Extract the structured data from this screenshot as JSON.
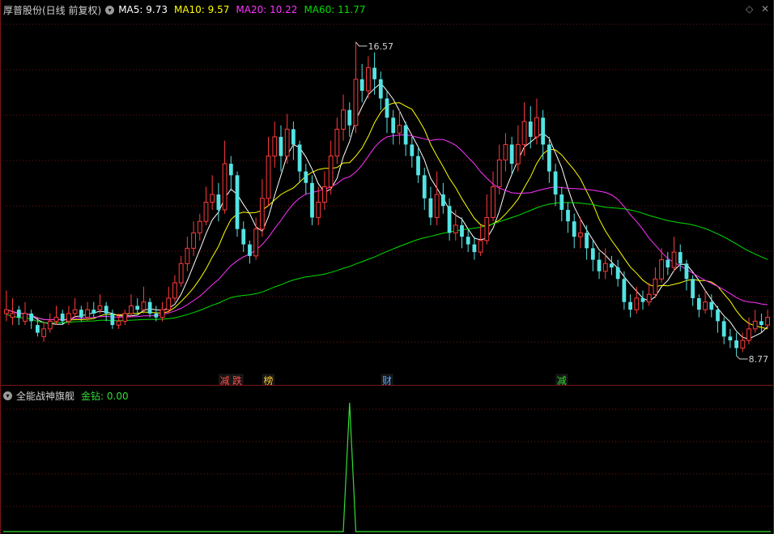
{
  "header": {
    "stock_name": "厚普股份(日线 前复权)",
    "dropdown_glyph": "▾",
    "ma": [
      {
        "label": "MA5: 9.73",
        "color": "#ffffff"
      },
      {
        "label": "MA10: 9.57",
        "color": "#ffff00"
      },
      {
        "label": "MA20: 10.22",
        "color": "#ff33ff"
      },
      {
        "label": "MA60: 11.77",
        "color": "#00e000"
      }
    ],
    "controls": [
      "◇",
      "✕"
    ]
  },
  "annotations": {
    "high": "16.57",
    "low": "8.77",
    "tags": [
      {
        "text": "减",
        "color": "#ff5050"
      },
      {
        "text": "跌",
        "color": "#ff5050"
      },
      {
        "text": "榜",
        "color": "#ffcc33"
      },
      {
        "text": "财",
        "color": "#55aaff"
      },
      {
        "text": "减",
        "color": "#33dd33"
      }
    ]
  },
  "indicator": {
    "name": "全能战神旗舰",
    "value_label": "金钻: 0.00",
    "value_color": "#33dd33"
  },
  "colors": {
    "up": "#ff3b3b",
    "down": "#54e3e3",
    "grid": "#7a1515"
  },
  "chart_data": {
    "type": "line",
    "ohlc": [
      [
        9.5,
        9.6,
        10.1,
        9.3
      ],
      [
        9.4,
        9.5,
        9.9,
        9.2
      ],
      [
        9.6,
        9.4,
        9.7,
        9.2
      ],
      [
        9.3,
        9.5,
        9.8,
        9.2
      ],
      [
        9.5,
        9.3,
        9.6,
        9.1
      ],
      [
        9.2,
        9.0,
        9.4,
        8.9
      ],
      [
        8.9,
        9.1,
        9.3,
        8.77
      ],
      [
        9.1,
        9.3,
        9.5,
        9.0
      ],
      [
        9.3,
        9.4,
        9.7,
        9.2
      ],
      [
        9.5,
        9.3,
        9.6,
        9.2
      ],
      [
        9.3,
        9.5,
        9.7,
        9.2
      ],
      [
        9.5,
        9.6,
        9.9,
        9.4
      ],
      [
        9.6,
        9.4,
        9.7,
        9.3
      ],
      [
        9.4,
        9.6,
        9.8,
        9.3
      ],
      [
        9.6,
        9.5,
        9.8,
        9.4
      ],
      [
        9.6,
        9.7,
        10.0,
        9.5
      ],
      [
        9.7,
        9.5,
        9.8,
        9.3
      ],
      [
        9.5,
        9.2,
        9.6,
        9.1
      ],
      [
        9.2,
        9.3,
        9.5,
        9.1
      ],
      [
        9.3,
        9.5,
        9.6,
        9.2
      ],
      [
        9.5,
        9.7,
        10.0,
        9.4
      ],
      [
        9.7,
        9.6,
        9.9,
        9.5
      ],
      [
        9.6,
        9.8,
        10.2,
        9.5
      ],
      [
        9.8,
        9.5,
        9.9,
        9.4
      ],
      [
        9.5,
        9.4,
        9.7,
        9.3
      ],
      [
        9.4,
        9.6,
        9.8,
        9.3
      ],
      [
        9.6,
        9.9,
        10.2,
        9.5
      ],
      [
        9.9,
        10.3,
        10.5,
        9.8
      ],
      [
        10.3,
        10.8,
        11.0,
        10.2
      ],
      [
        10.8,
        11.2,
        11.5,
        10.6
      ],
      [
        11.2,
        11.6,
        11.9,
        11.0
      ],
      [
        11.6,
        11.9,
        12.1,
        11.4
      ],
      [
        11.9,
        12.4,
        12.8,
        11.8
      ],
      [
        12.4,
        12.6,
        13.1,
        12.2
      ],
      [
        12.6,
        12.2,
        12.9,
        11.9
      ],
      [
        12.2,
        13.4,
        14.0,
        12.1
      ],
      [
        13.4,
        13.1,
        13.6,
        12.7
      ],
      [
        13.1,
        11.7,
        13.2,
        11.5
      ],
      [
        11.7,
        11.3,
        11.9,
        11.1
      ],
      [
        11.3,
        11.0,
        11.4,
        10.8
      ],
      [
        11.0,
        11.7,
        12.0,
        10.9
      ],
      [
        11.7,
        12.5,
        13.0,
        11.5
      ],
      [
        12.5,
        13.6,
        14.1,
        12.3
      ],
      [
        13.6,
        14.1,
        14.5,
        13.3
      ],
      [
        14.1,
        13.6,
        14.4,
        13.2
      ],
      [
        13.6,
        14.3,
        14.7,
        13.4
      ],
      [
        14.3,
        13.9,
        14.5,
        13.5
      ],
      [
        13.9,
        13.2,
        14.0,
        12.9
      ],
      [
        13.2,
        12.9,
        13.4,
        12.6
      ],
      [
        12.9,
        12.0,
        13.1,
        11.8
      ],
      [
        12.0,
        12.4,
        12.8,
        11.8
      ],
      [
        12.4,
        12.8,
        13.2,
        12.2
      ],
      [
        12.8,
        13.6,
        14.0,
        12.6
      ],
      [
        13.6,
        14.3,
        14.6,
        13.4
      ],
      [
        14.3,
        14.8,
        15.2,
        14.0
      ],
      [
        14.8,
        14.4,
        15.0,
        14.1
      ],
      [
        14.4,
        15.6,
        16.57,
        14.2
      ],
      [
        15.6,
        15.3,
        16.0,
        15.0
      ],
      [
        15.3,
        15.9,
        16.2,
        15.1
      ],
      [
        15.9,
        15.6,
        16.3,
        15.2
      ],
      [
        15.6,
        15.1,
        15.8,
        14.8
      ],
      [
        15.1,
        14.6,
        15.3,
        14.2
      ],
      [
        14.6,
        14.2,
        14.8,
        13.9
      ],
      [
        14.2,
        14.4,
        14.8,
        13.9
      ],
      [
        14.4,
        13.9,
        14.5,
        13.6
      ],
      [
        13.9,
        13.6,
        14.1,
        13.3
      ],
      [
        13.6,
        13.1,
        13.8,
        12.9
      ],
      [
        13.1,
        12.5,
        13.3,
        12.2
      ],
      [
        12.5,
        12.0,
        12.8,
        11.8
      ],
      [
        12.0,
        12.6,
        13.2,
        11.8
      ],
      [
        12.6,
        12.3,
        12.9,
        12.1
      ],
      [
        12.3,
        11.6,
        12.5,
        11.4
      ],
      [
        11.6,
        11.8,
        12.2,
        11.4
      ],
      [
        11.8,
        11.5,
        12.0,
        11.2
      ],
      [
        11.5,
        11.3,
        11.7,
        11.1
      ],
      [
        11.3,
        11.1,
        11.5,
        10.9
      ],
      [
        11.1,
        11.4,
        11.8,
        11.0
      ],
      [
        11.4,
        12.0,
        12.6,
        11.3
      ],
      [
        12.0,
        12.8,
        13.2,
        11.9
      ],
      [
        12.8,
        13.5,
        13.9,
        12.6
      ],
      [
        13.5,
        13.9,
        14.2,
        13.2
      ],
      [
        13.9,
        13.4,
        14.1,
        13.1
      ],
      [
        13.4,
        13.9,
        14.4,
        13.2
      ],
      [
        13.9,
        14.5,
        15.0,
        13.6
      ],
      [
        14.5,
        14.1,
        14.9,
        13.8
      ],
      [
        14.1,
        14.6,
        15.1,
        13.9
      ],
      [
        14.6,
        13.9,
        14.8,
        13.5
      ],
      [
        13.9,
        13.2,
        14.1,
        12.9
      ],
      [
        13.2,
        12.6,
        13.4,
        12.3
      ],
      [
        12.6,
        12.2,
        12.8,
        11.9
      ],
      [
        12.2,
        11.9,
        12.4,
        11.6
      ],
      [
        11.9,
        11.5,
        12.1,
        11.2
      ],
      [
        11.5,
        11.6,
        12.0,
        11.2
      ],
      [
        11.6,
        11.2,
        11.8,
        10.9
      ],
      [
        11.2,
        10.9,
        11.4,
        10.6
      ],
      [
        10.9,
        10.6,
        11.1,
        10.4
      ],
      [
        10.6,
        10.8,
        11.2,
        10.4
      ],
      [
        10.8,
        10.7,
        11.0,
        10.5
      ],
      [
        10.7,
        10.4,
        10.9,
        10.2
      ],
      [
        10.4,
        9.8,
        10.6,
        9.6
      ],
      [
        9.8,
        9.6,
        10.0,
        9.4
      ],
      [
        9.6,
        9.9,
        10.2,
        9.5
      ],
      [
        9.9,
        9.8,
        10.1,
        9.6
      ],
      [
        9.8,
        10.0,
        10.3,
        9.7
      ],
      [
        10.0,
        10.4,
        10.7,
        9.9
      ],
      [
        10.4,
        10.9,
        11.2,
        10.3
      ],
      [
        10.9,
        10.7,
        11.1,
        10.5
      ],
      [
        10.7,
        11.1,
        11.5,
        10.6
      ],
      [
        11.1,
        10.8,
        11.3,
        10.6
      ],
      [
        10.8,
        10.4,
        10.9,
        10.1
      ],
      [
        10.4,
        9.9,
        10.5,
        9.7
      ],
      [
        9.9,
        9.6,
        10.0,
        9.4
      ],
      [
        9.6,
        9.8,
        10.1,
        9.5
      ],
      [
        9.8,
        9.6,
        10.0,
        9.4
      ],
      [
        9.6,
        9.3,
        9.7,
        9.0
      ],
      [
        9.3,
        8.9,
        9.4,
        8.7
      ],
      [
        8.9,
        8.8,
        9.1,
        8.6
      ],
      [
        8.8,
        8.6,
        9.0,
        8.4
      ],
      [
        8.6,
        8.8,
        9.0,
        8.5
      ],
      [
        8.8,
        9.1,
        9.4,
        8.7
      ],
      [
        9.1,
        9.3,
        9.6,
        9.0
      ],
      [
        9.3,
        9.2,
        9.5,
        9.0
      ],
      [
        9.2,
        9.4,
        9.6,
        9.1
      ]
    ],
    "ma_periods": [
      5,
      10,
      20,
      60
    ],
    "ylim": [
      8.0,
      17.2
    ],
    "indicator_values": {
      "spike_index": 55,
      "spike_value": 1,
      "base_value": 0
    }
  }
}
